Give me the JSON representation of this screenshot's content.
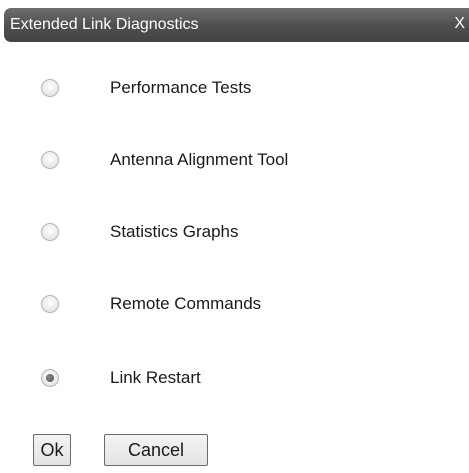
{
  "dialog": {
    "title": "Extended Link Diagnostics",
    "close_label": "X"
  },
  "options": [
    {
      "label": "Performance Tests",
      "checked": false
    },
    {
      "label": "Antenna Alignment Tool",
      "checked": false
    },
    {
      "label": "Statistics Graphs",
      "checked": false
    },
    {
      "label": "Remote Commands",
      "checked": false
    },
    {
      "label": "Link Restart",
      "checked": true
    }
  ],
  "buttons": {
    "ok_label": "Ok",
    "cancel_label": "Cancel"
  }
}
